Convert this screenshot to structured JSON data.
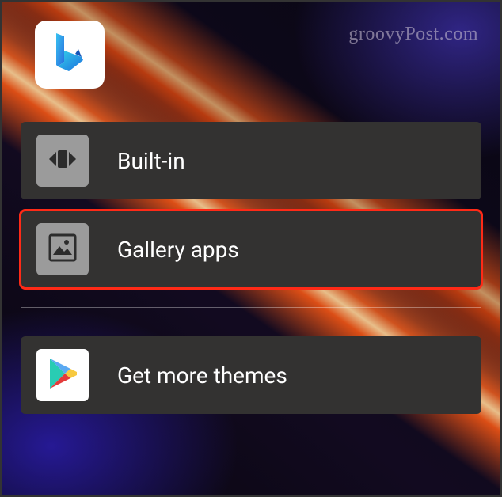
{
  "watermark": "groovyPost.com",
  "app_tile": {
    "name": "bing-app"
  },
  "options": {
    "builtin": {
      "label": "Built-in"
    },
    "gallery": {
      "label": "Gallery apps"
    },
    "getmore": {
      "label": "Get more themes"
    }
  },
  "highlight_color": "#ff2a17"
}
